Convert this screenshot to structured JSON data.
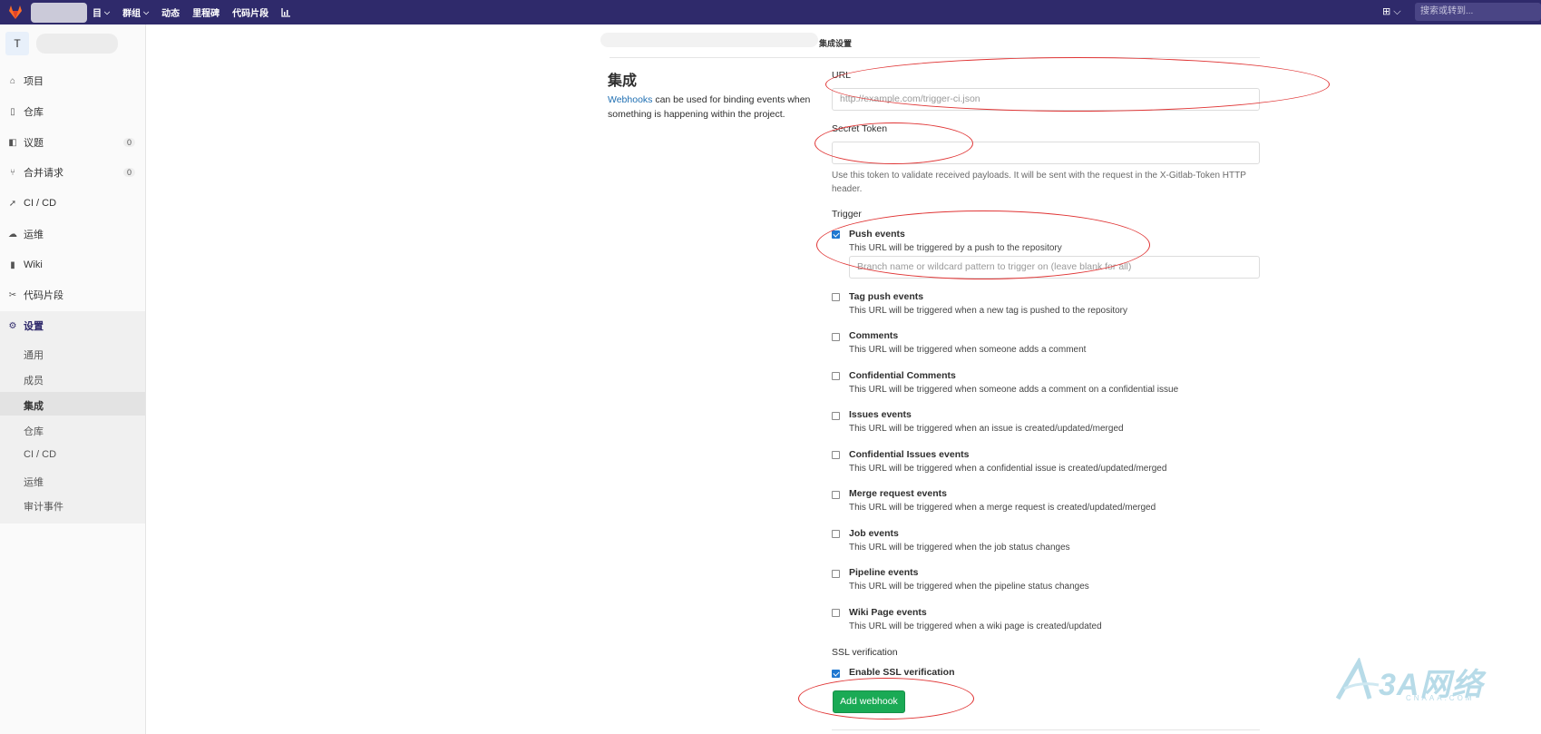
{
  "topbar": {
    "nav": [
      {
        "label": "目",
        "has_chevron": true
      },
      {
        "label": "群组",
        "has_chevron": true
      },
      {
        "label": "动态",
        "has_chevron": false
      },
      {
        "label": "里程碑",
        "has_chevron": false
      },
      {
        "label": "代码片段",
        "has_chevron": false
      }
    ],
    "search_placeholder": "搜索或转到..."
  },
  "sidebar": {
    "avatar_letter": "T",
    "items": [
      {
        "label": "项目",
        "icon": "home-icon",
        "count": ""
      },
      {
        "label": "仓库",
        "icon": "doc-icon",
        "count": ""
      },
      {
        "label": "议题",
        "icon": "issues-icon",
        "count": "0"
      },
      {
        "label": "合并请求",
        "icon": "merge-icon",
        "count": "0"
      },
      {
        "label": "CI / CD",
        "icon": "rocket-icon",
        "count": ""
      },
      {
        "label": "运维",
        "icon": "cloud-icon",
        "count": ""
      },
      {
        "label": "Wiki",
        "icon": "book-icon",
        "count": ""
      },
      {
        "label": "代码片段",
        "icon": "scissors-icon",
        "count": ""
      },
      {
        "label": "设置",
        "icon": "gear-icon",
        "count": ""
      }
    ],
    "sub_items": [
      "通用",
      "成员",
      "集成",
      "仓库",
      "CI / CD",
      "运维",
      "审计事件"
    ],
    "current_sub": "集成"
  },
  "breadcrumb": {
    "current": "集成设置"
  },
  "intro": {
    "title": "集成",
    "link_text": "Webhooks",
    "desc": " can be used for binding events when something is happening within the project."
  },
  "form": {
    "url_label": "URL",
    "url_placeholder": "http://example.com/trigger-ci.json",
    "token_label": "Secret Token",
    "token_help": "Use this token to validate received payloads. It will be sent with the request in the X-Gitlab-Token HTTP header.",
    "trigger_label": "Trigger",
    "branch_placeholder": "Branch name or wildcard pattern to trigger on (leave blank for all)",
    "events": [
      {
        "title": "Push events",
        "desc": "This URL will be triggered by a push to the repository",
        "checked": true
      },
      {
        "title": "Tag push events",
        "desc": "This URL will be triggered when a new tag is pushed to the repository",
        "checked": false
      },
      {
        "title": "Comments",
        "desc": "This URL will be triggered when someone adds a comment",
        "checked": false
      },
      {
        "title": "Confidential Comments",
        "desc": "This URL will be triggered when someone adds a comment on a confidential issue",
        "checked": false
      },
      {
        "title": "Issues events",
        "desc": "This URL will be triggered when an issue is created/updated/merged",
        "checked": false
      },
      {
        "title": "Confidential Issues events",
        "desc": "This URL will be triggered when a confidential issue is created/updated/merged",
        "checked": false
      },
      {
        "title": "Merge request events",
        "desc": "This URL will be triggered when a merge request is created/updated/merged",
        "checked": false
      },
      {
        "title": "Job events",
        "desc": "This URL will be triggered when the job status changes",
        "checked": false
      },
      {
        "title": "Pipeline events",
        "desc": "This URL will be triggered when the pipeline status changes",
        "checked": false
      },
      {
        "title": "Wiki Page events",
        "desc": "This URL will be triggered when a wiki page is created/updated",
        "checked": false
      }
    ],
    "ssl_label": "SSL verification",
    "ssl_option": "Enable SSL verification",
    "ssl_checked": true,
    "submit_label": "Add webhook"
  },
  "watermark": {
    "text": "3A网络",
    "sub": "CNAAA.COM"
  },
  "colors": {
    "topbar": "#2f2a6b",
    "primary_btn": "#1aaa55",
    "link": "#1f6fb2",
    "annotation": "#e03535"
  }
}
